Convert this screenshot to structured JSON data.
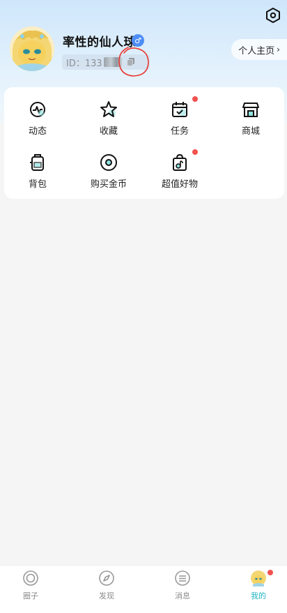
{
  "header": {
    "user_name": "率性的仙人球",
    "gender_symbol": "♂",
    "id_prefix": "ID：133",
    "profile_button": "个人主页",
    "profile_arrow": "›"
  },
  "menu": {
    "items": [
      {
        "label": "动态",
        "icon": "activity-icon",
        "badge": false
      },
      {
        "label": "收藏",
        "icon": "star-icon",
        "badge": false
      },
      {
        "label": "任务",
        "icon": "calendar-check-icon",
        "badge": true
      },
      {
        "label": "商城",
        "icon": "store-icon",
        "badge": false
      },
      {
        "label": "背包",
        "icon": "backpack-icon",
        "badge": false
      },
      {
        "label": "购买金币",
        "icon": "coin-icon",
        "badge": false
      },
      {
        "label": "超值好物",
        "icon": "shopping-bag-icon",
        "badge": true
      }
    ]
  },
  "bottom_nav": {
    "items": [
      {
        "label": "圈子",
        "icon": "circle-ring-icon",
        "active": false
      },
      {
        "label": "发现",
        "icon": "compass-icon",
        "active": false
      },
      {
        "label": "消息",
        "icon": "message-list-icon",
        "active": false
      },
      {
        "label": "我的",
        "icon": "avatar-icon",
        "active": true,
        "badge": true
      }
    ]
  },
  "colors": {
    "accent": "#22b5c8",
    "badge_red": "#f0524f",
    "gender_blue": "#4d8ef7",
    "annotation_red": "#e8352f"
  }
}
